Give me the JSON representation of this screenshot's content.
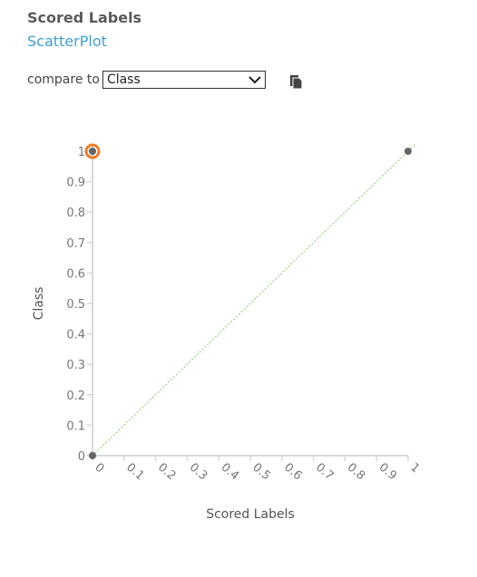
{
  "header": {
    "title": "Scored Labels",
    "subtitle": "ScatterPlot"
  },
  "compare": {
    "label": "compare to",
    "selected": "Class"
  },
  "icons": {
    "dropdown": "chevron-down-icon",
    "copy": "copy-icon"
  },
  "colors": {
    "point": "#666666",
    "highlight": "#f07c28",
    "diagonal": "#8cc868",
    "axis": "#d9d9d9"
  },
  "chart_data": {
    "type": "scatter",
    "xlabel": "Scored Labels",
    "ylabel": "Class",
    "xlim": [
      0,
      1
    ],
    "ylim": [
      0,
      1
    ],
    "xticks": [
      "0",
      "0.1",
      "0.2",
      "0.3",
      "0.4",
      "0.5",
      "0.6",
      "0.7",
      "0.8",
      "0.9",
      "1"
    ],
    "yticks": [
      "0",
      "0.1",
      "0.2",
      "0.3",
      "0.4",
      "0.5",
      "0.6",
      "0.7",
      "0.8",
      "0.9",
      "1"
    ],
    "points": [
      {
        "x": 0,
        "y": 1,
        "highlighted": true
      },
      {
        "x": 1,
        "y": 1
      },
      {
        "x": 0,
        "y": 0
      }
    ],
    "reference_line": "y = x",
    "grid": false
  }
}
